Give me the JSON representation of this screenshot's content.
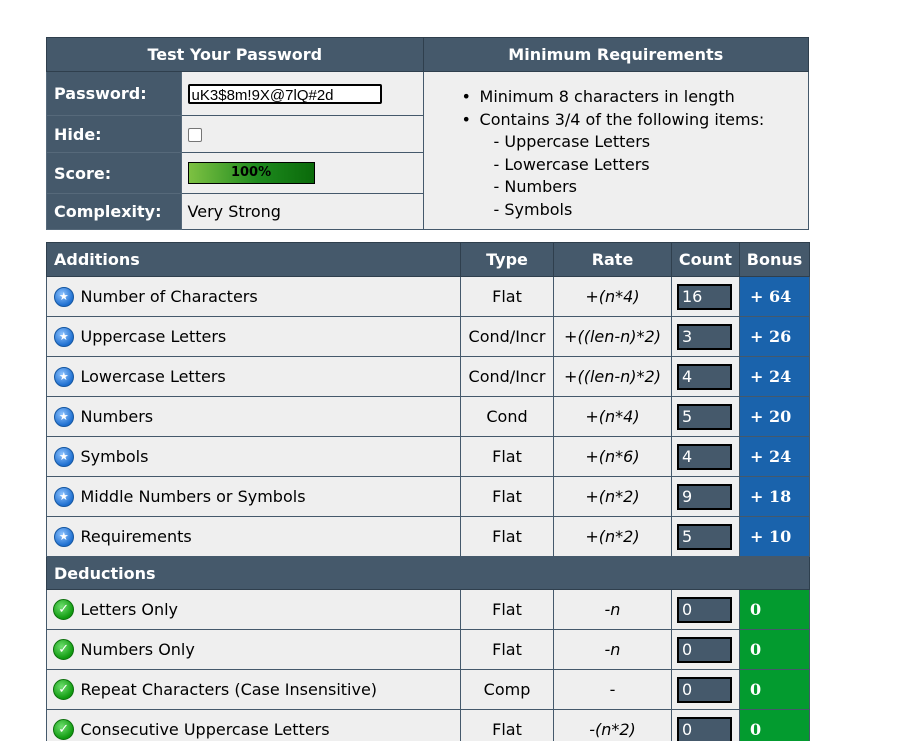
{
  "top": {
    "headers": {
      "test": "Test Your Password",
      "requirements": "Minimum Requirements"
    },
    "password": {
      "label": "Password:",
      "value": "uK3$8m!9X@7lQ#2d"
    },
    "hide": {
      "label": "Hide:",
      "checked": false
    },
    "score": {
      "label": "Score:",
      "value": "100%",
      "percent": 100
    },
    "complexity": {
      "label": "Complexity:",
      "value": "Very Strong"
    },
    "requirements": {
      "items": [
        "Minimum 8 characters in length",
        "Contains 3/4 of the following items:"
      ],
      "sub_items": [
        "- Uppercase Letters",
        "- Lowercase Letters",
        "- Numbers",
        "- Symbols"
      ]
    }
  },
  "table": {
    "columns": {
      "additions": "Additions",
      "type": "Type",
      "rate": "Rate",
      "count": "Count",
      "bonus": "Bonus"
    },
    "additions": [
      {
        "name": "Number of Characters",
        "type": "Flat",
        "rate": "+(n*4)",
        "count": "16",
        "bonus": "+ 64"
      },
      {
        "name": "Uppercase Letters",
        "type": "Cond/Incr",
        "rate": "+((len-n)*2)",
        "count": "3",
        "bonus": "+ 26"
      },
      {
        "name": "Lowercase Letters",
        "type": "Cond/Incr",
        "rate": "+((len-n)*2)",
        "count": "4",
        "bonus": "+ 24"
      },
      {
        "name": "Numbers",
        "type": "Cond",
        "rate": "+(n*4)",
        "count": "5",
        "bonus": "+ 20"
      },
      {
        "name": "Symbols",
        "type": "Flat",
        "rate": "+(n*6)",
        "count": "4",
        "bonus": "+ 24"
      },
      {
        "name": "Middle Numbers or Symbols",
        "type": "Flat",
        "rate": "+(n*2)",
        "count": "9",
        "bonus": "+ 18"
      },
      {
        "name": "Requirements",
        "type": "Flat",
        "rate": "+(n*2)",
        "count": "5",
        "bonus": "+ 10"
      }
    ],
    "deductions_label": "Deductions",
    "deductions": [
      {
        "name": "Letters Only",
        "type": "Flat",
        "rate": "-n",
        "count": "0",
        "bonus": "0"
      },
      {
        "name": "Numbers Only",
        "type": "Flat",
        "rate": "-n",
        "count": "0",
        "bonus": "0"
      },
      {
        "name": "Repeat Characters (Case Insensitive)",
        "type": "Comp",
        "rate": "-",
        "count": "0",
        "bonus": "0"
      },
      {
        "name": "Consecutive Uppercase Letters",
        "type": "Flat",
        "rate": "-(n*2)",
        "count": "0",
        "bonus": "0"
      }
    ]
  },
  "icons": {
    "addition": "star-icon",
    "deduction": "check-icon"
  },
  "colors": {
    "header": "#45596b",
    "bonus_blue": "#1a63ac",
    "bonus_green": "#039b2f",
    "cell": "#efefef"
  }
}
